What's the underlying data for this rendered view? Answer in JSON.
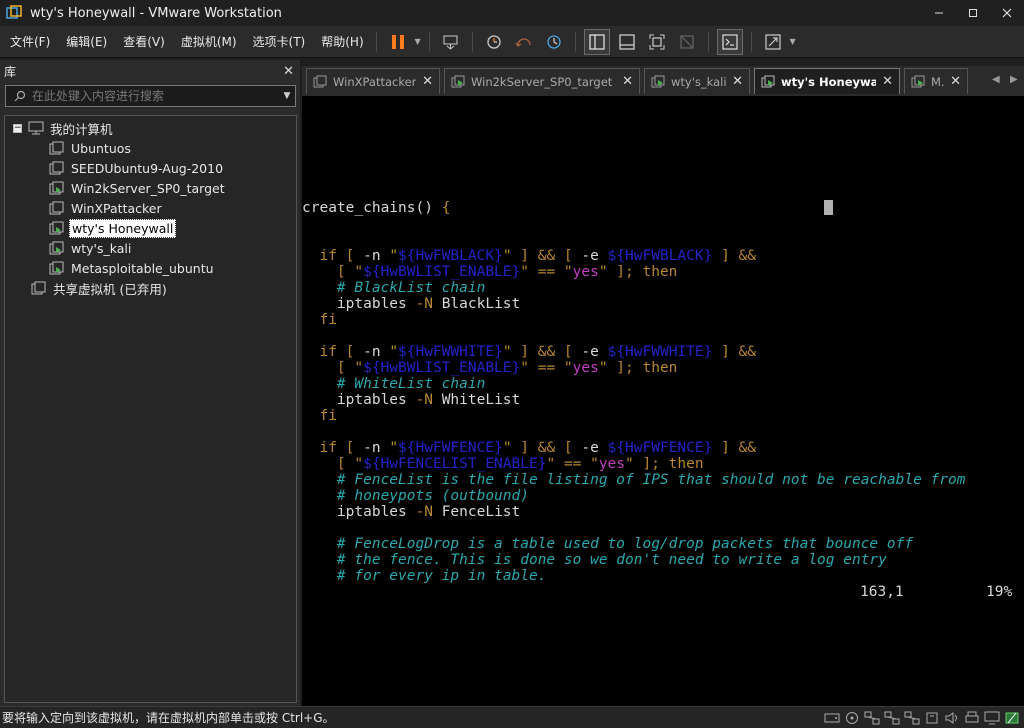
{
  "window": {
    "title": "wty's Honeywall - VMware Workstation"
  },
  "menu": [
    "文件(F)",
    "编辑(E)",
    "查看(V)",
    "虚拟机(M)",
    "选项卡(T)",
    "帮助(H)"
  ],
  "library": {
    "title": "库",
    "search_placeholder": "在此处键入内容进行搜索",
    "root": "我的计算机",
    "vms": [
      "Ubuntuos",
      "SEEDUbuntu9-Aug-2010",
      "Win2kServer_SP0_target",
      "WinXPattacker",
      "wty's Honeywall",
      "wty's_kali",
      "Metasploitable_ubuntu"
    ],
    "selected_vm": "wty's Honeywall",
    "shared": "共享虚拟机 (已弃用)"
  },
  "tabs": [
    {
      "label": "WinXPattacker",
      "active": false
    },
    {
      "label": "Win2kServer_SP0_target",
      "active": false
    },
    {
      "label": "wty's_kali",
      "active": false
    },
    {
      "label": "wty's Honeywall",
      "active": true
    },
    {
      "label": "M...",
      "active": false
    }
  ],
  "console": {
    "lines": [
      [
        [
          "w",
          "create_chains() "
        ],
        [
          "o",
          "{"
        ]
      ],
      [],
      [],
      [
        [
          "o",
          "  if [ "
        ],
        [
          "w",
          "-n "
        ],
        [
          "o",
          "\""
        ],
        [
          "b",
          "${HwFWBLACK}"
        ],
        [
          "o",
          "\" ] && [ "
        ],
        [
          "w",
          "-e "
        ],
        [
          "b",
          "${HwFWBLACK}"
        ],
        [
          "o",
          " ] &&"
        ]
      ],
      [
        [
          "o",
          "    [ \""
        ],
        [
          "b",
          "${HwBWLIST_ENABLE}"
        ],
        [
          "o",
          "\" == \""
        ],
        [
          "m",
          "yes"
        ],
        [
          "o",
          "\" ]; then"
        ]
      ],
      [
        [
          "w",
          "    "
        ],
        [
          "t",
          "# BlackList chain"
        ]
      ],
      [
        [
          "w",
          "    iptables "
        ],
        [
          "o",
          "-N"
        ],
        [
          "w",
          " BlackList"
        ]
      ],
      [
        [
          "o",
          "  fi"
        ]
      ],
      [],
      [
        [
          "o",
          "  if [ "
        ],
        [
          "w",
          "-n "
        ],
        [
          "o",
          "\""
        ],
        [
          "b",
          "${HwFWWHITE}"
        ],
        [
          "o",
          "\" ] && [ "
        ],
        [
          "w",
          "-e "
        ],
        [
          "b",
          "${HwFWWHITE}"
        ],
        [
          "o",
          " ] &&"
        ]
      ],
      [
        [
          "o",
          "    [ \""
        ],
        [
          "b",
          "${HwBWLIST_ENABLE}"
        ],
        [
          "o",
          "\" == \""
        ],
        [
          "m",
          "yes"
        ],
        [
          "o",
          "\" ]; then"
        ]
      ],
      [
        [
          "w",
          "    "
        ],
        [
          "t",
          "# WhiteList chain"
        ]
      ],
      [
        [
          "w",
          "    iptables "
        ],
        [
          "o",
          "-N"
        ],
        [
          "w",
          " WhiteList"
        ]
      ],
      [
        [
          "o",
          "  fi"
        ]
      ],
      [],
      [
        [
          "o",
          "  if [ "
        ],
        [
          "w",
          "-n "
        ],
        [
          "o",
          "\""
        ],
        [
          "b",
          "${HwFWFENCE}"
        ],
        [
          "o",
          "\" ] && [ "
        ],
        [
          "w",
          "-e "
        ],
        [
          "b",
          "${HwFWFENCE}"
        ],
        [
          "o",
          " ] &&"
        ]
      ],
      [
        [
          "o",
          "    [ \""
        ],
        [
          "b",
          "${HwFENCELIST_ENABLE}"
        ],
        [
          "o",
          "\" == \""
        ],
        [
          "m",
          "yes"
        ],
        [
          "o",
          "\" ]; then"
        ]
      ],
      [
        [
          "w",
          "    "
        ],
        [
          "t",
          "# FenceList is the file listing of IPS that should not be reachable from"
        ]
      ],
      [
        [
          "w",
          "    "
        ],
        [
          "t",
          "# honeypots (outbound)"
        ]
      ],
      [
        [
          "w",
          "    iptables "
        ],
        [
          "o",
          "-N"
        ],
        [
          "w",
          " FenceList"
        ]
      ],
      [],
      [
        [
          "w",
          "    "
        ],
        [
          "t",
          "# FenceLogDrop is a table used to log/drop packets that bounce off"
        ]
      ],
      [
        [
          "w",
          "    "
        ],
        [
          "t",
          "# the fence. This is done so we don't need to write a log entry"
        ]
      ],
      [
        [
          "w",
          "    "
        ],
        [
          "t",
          "# for every ip in table."
        ]
      ]
    ],
    "status_position": "163,1",
    "status_percent": "19%"
  },
  "statusbar": {
    "text": "要将输入定向到该虚拟机，请在虚拟机内部单击或按 Ctrl+G。"
  }
}
